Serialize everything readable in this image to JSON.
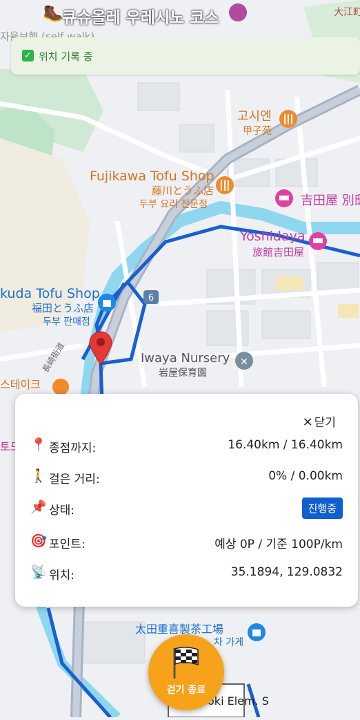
{
  "header": {
    "title": "큐슈올레 우레시노 코스",
    "title_emoji": "🥾",
    "ghost_subtitle": "자율보행 (self walk)"
  },
  "status": {
    "check_symbol": "✓",
    "text": "위치 기록 중"
  },
  "map_labels": {
    "ureshino_top": "大江町",
    "goshien_ko": "고시엔",
    "goshien_jp": "甲子苑",
    "fujikawa_en": "Fujikawa Tofu Shop",
    "fujikawa_jp": "藤川とうふ店",
    "fujikawa_ko": "두부 요리 전문점",
    "yoshidaya_jp_right": "吉田屋 別邸",
    "yoshidaya_en": "Yoshidaya",
    "yoshidaya_jp": "旅館吉田屋",
    "fukuda_en": "kuda Tofu Shop",
    "fukuda_jp": "福田とうふ店",
    "fukuda_ko": "두부 판매점",
    "route_no": "6",
    "nagasaki_road": "長崎街道",
    "iwaya_en": "Iwaya Nursery",
    "iwaya_jp": "岩屋保育園",
    "steak_ko": "스테이크",
    "ota_jp": "太田重喜製茶工場",
    "ota_ko": "차 가게",
    "todoroki": "Todoroki Elem. S",
    "left_edge": "토드"
  },
  "panel": {
    "close_label": "닫기",
    "rows": [
      {
        "icon": "📍",
        "label": "종점까지:",
        "value": "16.40km / 16.40km"
      },
      {
        "icon": "🚶",
        "label": "걸은 거리:",
        "value": "0% / 0.00km"
      },
      {
        "icon": "📌",
        "label": "상태:",
        "value": "진행중"
      },
      {
        "icon": "🎯",
        "label": "포인트:",
        "value": "예상 0P / 기준 100P/km"
      },
      {
        "icon": "📡",
        "label": "위치:",
        "value": "35.1894, 129.0832"
      }
    ]
  },
  "fab": {
    "label": "걷기 종료"
  },
  "colors": {
    "route": "#1a5fd0",
    "river": "#8fd7ef",
    "accent_orange": "#f7a21b",
    "status_badge": "#0f5fd0"
  }
}
